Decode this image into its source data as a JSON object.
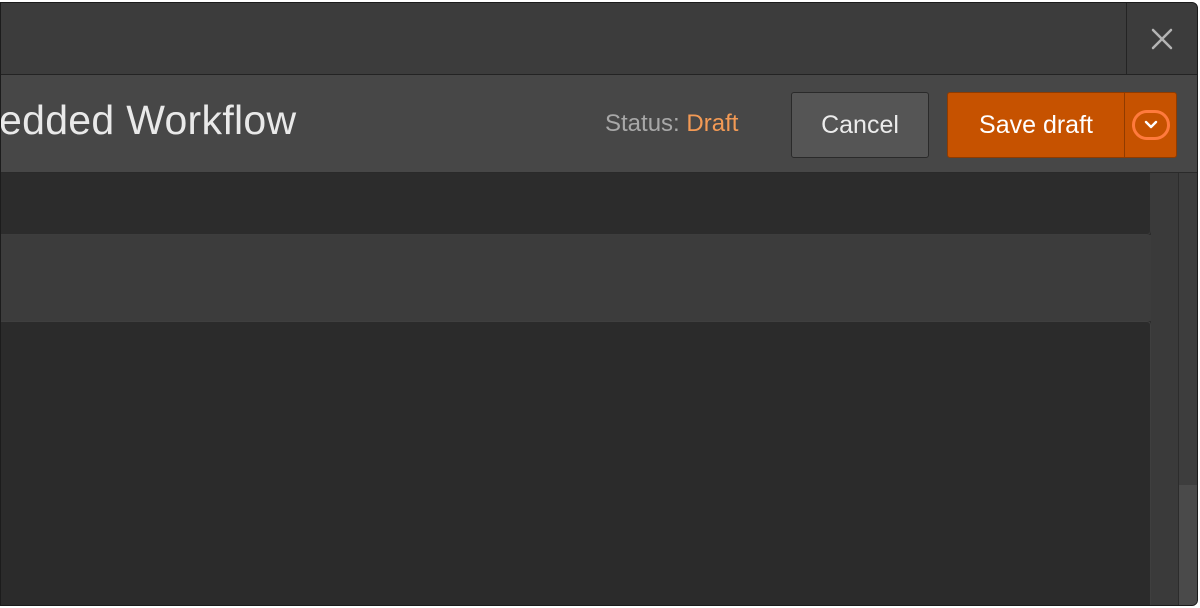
{
  "dialog": {
    "title": "edded Workflow",
    "close_icon": "close-icon"
  },
  "header": {
    "status_label": "Status:",
    "status_value": "Draft",
    "status_color": "#f39a55"
  },
  "actions": {
    "cancel_label": "Cancel",
    "save_label": "Save draft",
    "save_color": "#c65200",
    "dropdown_icon": "chevron-down-icon"
  }
}
